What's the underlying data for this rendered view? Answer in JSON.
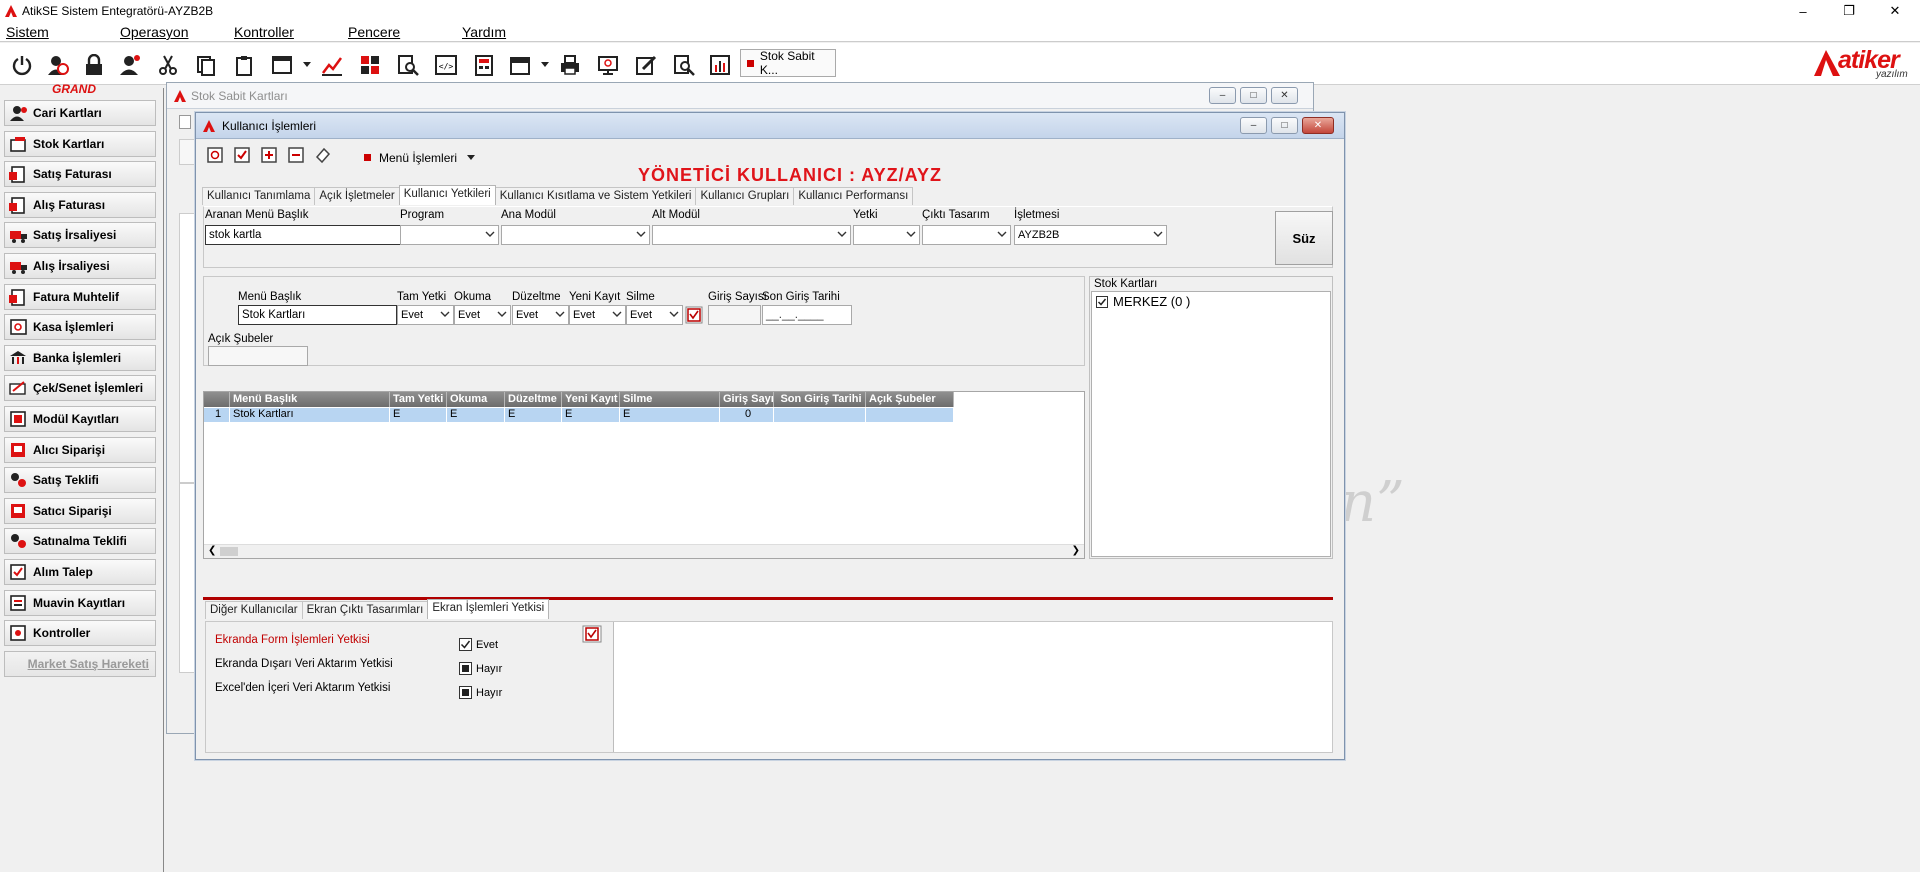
{
  "app": {
    "title": "AtikSE Sistem Entegratörü-AYZB2B",
    "menu": [
      "Sistem",
      "Operasyon",
      "Kontroller",
      "Pencere",
      "Yardım"
    ],
    "grand_label": "GRAND",
    "active_window_tab": "Stok Sabit K...",
    "brand_name": "atiker",
    "brand_sub": "yazılım"
  },
  "sidebar": {
    "items": [
      {
        "label": "Cari Kartları",
        "icon": "person-icon"
      },
      {
        "label": "Stok Kartları",
        "icon": "box-icon"
      },
      {
        "label": "Satış Faturası",
        "icon": "invoice-icon"
      },
      {
        "label": "Alış Faturası",
        "icon": "invoice-icon"
      },
      {
        "label": "Satış İrsaliyesi",
        "icon": "truck-icon"
      },
      {
        "label": "Alış İrsaliyesi",
        "icon": "truck-icon"
      },
      {
        "label": "Fatura Muhtelif",
        "icon": "invoice-icon"
      },
      {
        "label": "Kasa İşlemleri",
        "icon": "safe-icon"
      },
      {
        "label": "Banka İşlemleri",
        "icon": "bank-icon"
      },
      {
        "label": "Çek/Senet İşlemleri",
        "icon": "check-icon"
      },
      {
        "label": "Modül Kayıtları",
        "icon": "module-icon"
      },
      {
        "label": "Alıcı Siparişi",
        "icon": "order-icon"
      },
      {
        "label": "Satış Teklifi",
        "icon": "offer-icon"
      },
      {
        "label": "Satıcı Siparişi",
        "icon": "order-icon"
      },
      {
        "label": "Satınalma Teklifi",
        "icon": "offer-icon"
      },
      {
        "label": "Alım Talep",
        "icon": "request-icon"
      },
      {
        "label": "Muavin Kayıtları",
        "icon": "ledger-icon"
      },
      {
        "label": "Kontroller",
        "icon": "control-icon"
      }
    ],
    "disabled_item": "Market Satış Hareketi"
  },
  "bg_window": {
    "title": "Stok Sabit Kartları",
    "watermark": "n”"
  },
  "dialog": {
    "title": "Kullanıcı İşlemleri",
    "menu_button": "Menü İşlemleri",
    "heading": "YÖNETİCİ KULLANICI : AYZ/AYZ",
    "tabs": [
      "Kullanıcı Tanımlama",
      "Açık İşletmeler",
      "Kullanıcı Yetkileri",
      "Kullanıcı Kısıtlama ve Sistem Yetkileri",
      "Kullanıcı Grupları",
      "Kullanıcı Performansı"
    ],
    "active_tab": 2,
    "filters": {
      "search_label": "Aranan Menü Başlık",
      "search_value": "stok kartla",
      "program_label": "Program",
      "ana_modul_label": "Ana Modül",
      "alt_modul_label": "Alt Modül",
      "yetki_label": "Yetki",
      "cikti_label": "Çıktı Tasarım",
      "isletme_label": "İşletmesi",
      "isletme_value": "AYZB2B",
      "suz_button": "Süz"
    },
    "editor": {
      "menu_baslik_label": "Menü Başlık",
      "menu_baslik_value": "Stok Kartları",
      "tam_yetki_label": "Tam Yetki",
      "tam_yetki_value": "Evet",
      "okuma_label": "Okuma",
      "okuma_value": "Evet",
      "duzeltme_label": "Düzeltme",
      "duzeltme_value": "Evet",
      "yeni_kayit_label": "Yeni Kayıt",
      "yeni_kayit_value": "Evet",
      "silme_label": "Silme",
      "silme_value": "Evet",
      "giris_sayisi_label": "Giriş Sayısı",
      "son_giris_label": "Son Giriş Tarihi",
      "son_giris_value": "__.__.____",
      "acik_subeler_label": "Açık Şubeler"
    },
    "grid": {
      "headers": [
        "Menü Başlık",
        "Tam Yetki",
        "Okuma",
        "Düzeltme",
        "Yeni Kayıt",
        "Silme",
        "Giriş Sayısı",
        "Son Giriş Tarihi",
        "Açık Şubeler"
      ],
      "rows": [
        {
          "num": "1",
          "cells": [
            "Stok Kartları",
            "E",
            "E",
            "E",
            "E",
            "E",
            "0",
            "",
            ""
          ]
        }
      ]
    },
    "branches": {
      "title": "Stok Kartları",
      "items": [
        {
          "label": "MERKEZ  (0 )",
          "checked": true
        }
      ]
    },
    "bottom_tabs": [
      "Diğer Kullanıcılar",
      "Ekran Çıktı Tasarımları",
      "Ekran İşlemleri Yetkisi"
    ],
    "bottom_active": 2,
    "perms": [
      {
        "label": "Ekranda Form İşlemleri Yetkisi",
        "value": "Evet",
        "checked": true,
        "highlight": true
      },
      {
        "label": "Ekranda Dışarı Veri Aktarım Yetkisi",
        "value": "Hayır",
        "checked": false,
        "highlight": false
      },
      {
        "label": "Excel'den İçeri Veri Aktarım Yetkisi",
        "value": "Hayır",
        "checked": false,
        "highlight": false
      }
    ]
  },
  "colors": {
    "accent_red": "#e0141a",
    "grid_header": "#7a7a7a",
    "row_select": "#b8d5f2",
    "title_gradient": "#c4d4ea"
  }
}
